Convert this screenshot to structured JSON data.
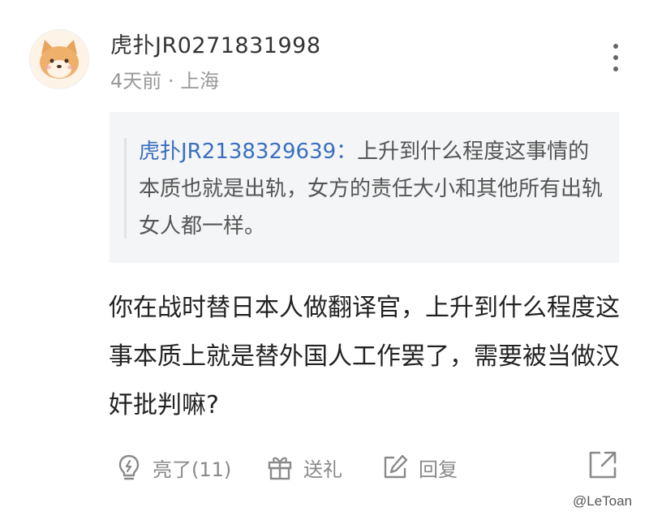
{
  "comment": {
    "username": "虎扑JR0271831998",
    "meta": "4天前 · 上海",
    "quote": {
      "username": "虎扑JR2138329639：",
      "text": "上升到什么程度这事情的本质也就是出轨，女方的责任大小和其他所有出轨女人都一样。"
    },
    "body": "你在战时替日本人做翻译官，上升到什么程度这事本质上就是替外国人工作罢了，需要被当做汉奸批判嘛?",
    "actions": {
      "like": "亮了(11)",
      "gift": "送礼",
      "reply": "回复"
    }
  },
  "watermark": "@LeToan",
  "icons": {
    "avatar": "shiba-dog-avatar",
    "more": "more-vertical-icon",
    "like": "lightbulb-icon",
    "gift": "gift-icon",
    "reply": "edit-icon",
    "share": "share-icon"
  }
}
